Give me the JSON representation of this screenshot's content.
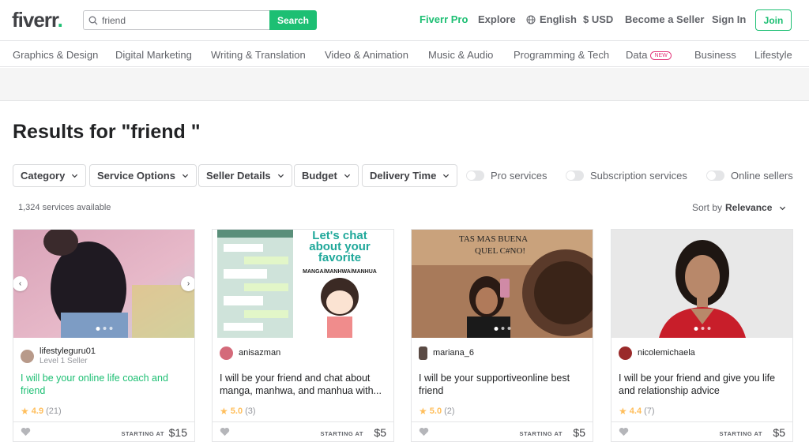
{
  "header": {
    "logo": "fiverr",
    "logo_dot": ".",
    "search_value": "friend",
    "search_button": "Search",
    "nav": {
      "pro": "Fiverr Pro",
      "explore": "Explore",
      "language": "English",
      "currency": "$ USD",
      "become_seller": "Become a Seller",
      "sign_in": "Sign In",
      "join": "Join"
    }
  },
  "categories": [
    "Graphics & Design",
    "Digital Marketing",
    "Writing & Translation",
    "Video & Animation",
    "Music & Audio",
    "Programming & Tech",
    "Data",
    "Business",
    "Lifestyle"
  ],
  "new_badge": "NEW",
  "results_title": "Results for \"friend \"",
  "filters": [
    "Category",
    "Service Options",
    "Seller Details",
    "Budget",
    "Delivery Time"
  ],
  "toggles": [
    "Pro services",
    "Subscription services",
    "Online sellers"
  ],
  "services_count": "1,324 services available",
  "sort": {
    "label": "Sort by",
    "value": "Relevance"
  },
  "cards": [
    {
      "seller": "lifestyleguru01",
      "level": "Level 1 Seller",
      "title": "I will be your online life coach and friend",
      "rating": "4.9",
      "reviews": "(21)",
      "starting": "STARTING AT",
      "price": "$15"
    },
    {
      "seller": "anisazman",
      "level": "",
      "title": "I will be your friend and chat about manga, manhwa, and manhua with...",
      "rating": "5.0",
      "reviews": "(3)",
      "starting": "STARTING AT",
      "price": "$5",
      "thumb_text": [
        "Let's chat",
        "about your",
        "favorite",
        "MANGA/MANHWA/MANHUA"
      ]
    },
    {
      "seller": "mariana_6",
      "level": "",
      "title": "I will be your supportiveonline best friend",
      "rating": "5.0",
      "reviews": "(2)",
      "starting": "STARTING AT",
      "price": "$5",
      "thumb_text": [
        "TAS MAS BUENA",
        "QUEL C#NO!"
      ]
    },
    {
      "seller": "nicolemichaela",
      "level": "",
      "title": "I will be your friend and give you life and relationship advice",
      "rating": "4.4",
      "reviews": "(7)",
      "starting": "STARTING AT",
      "price": "$5"
    }
  ],
  "colors": {
    "brand": "#1dbf73",
    "star": "#ffbe5b",
    "new": "#e3367a"
  }
}
